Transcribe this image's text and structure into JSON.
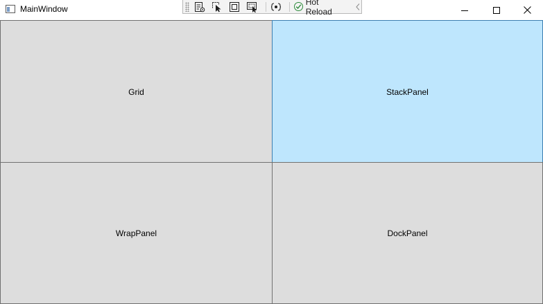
{
  "window": {
    "title": "MainWindow",
    "icon": "window-app-icon"
  },
  "debug_toolbar": {
    "tools": [
      {
        "icon": "live-visual-tree-icon"
      },
      {
        "icon": "select-element-icon"
      },
      {
        "icon": "display-layout-adorners-icon"
      },
      {
        "icon": "track-focused-element-icon"
      },
      {
        "icon": "binding-failures-icon"
      }
    ],
    "hot_reload_label": "Hot Reload",
    "hot_reload_status": "ok",
    "collapse_icon": "chevron-left-icon"
  },
  "caption_buttons": {
    "minimize": "minimize-icon",
    "maximize": "maximize-icon",
    "close": "close-icon"
  },
  "panels": {
    "grid": {
      "label": "Grid",
      "state": "normal"
    },
    "stack": {
      "label": "StackPanel",
      "state": "hover"
    },
    "wrap": {
      "label": "WrapPanel",
      "state": "normal"
    },
    "dock": {
      "label": "DockPanel",
      "state": "normal"
    }
  },
  "colors": {
    "button_face": "#dddddd",
    "button_border": "#707070",
    "hover_face": "#bee6fd",
    "hover_border": "#3c7fb1",
    "hot_reload_ok": "#2c8a3a"
  }
}
